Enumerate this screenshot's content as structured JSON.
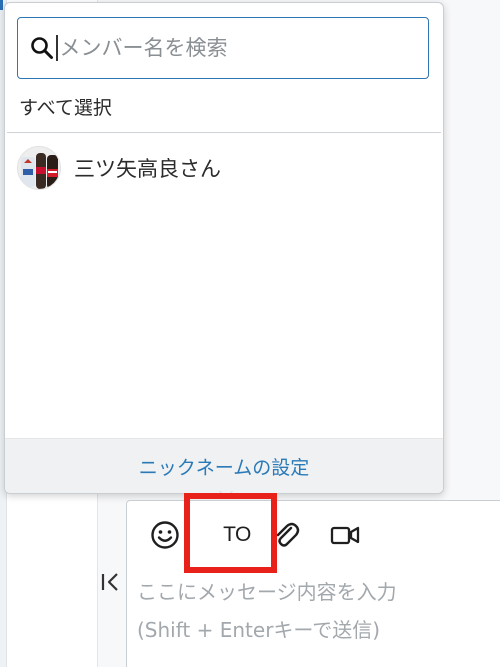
{
  "mention_popup": {
    "search": {
      "placeholder": "メンバー名を検索",
      "value": ""
    },
    "select_all_label": "すべて選択",
    "members": [
      {
        "name": "三ツ矢高良さん",
        "avatar": "avatar-photo"
      }
    ],
    "footer_link": "ニックネームの設定"
  },
  "composer": {
    "toolbar": {
      "emoji_icon": "smiley-icon",
      "to_label": "TO",
      "attach_icon": "paperclip-icon",
      "video_icon": "video-camera-icon"
    },
    "message_placeholder": "ここにメッセージ内容を入力\n(Shift + Enterキーで送信)"
  },
  "colors": {
    "accent": "#2f74b5",
    "link": "#2a7ab8",
    "highlight": "#e8221b"
  }
}
